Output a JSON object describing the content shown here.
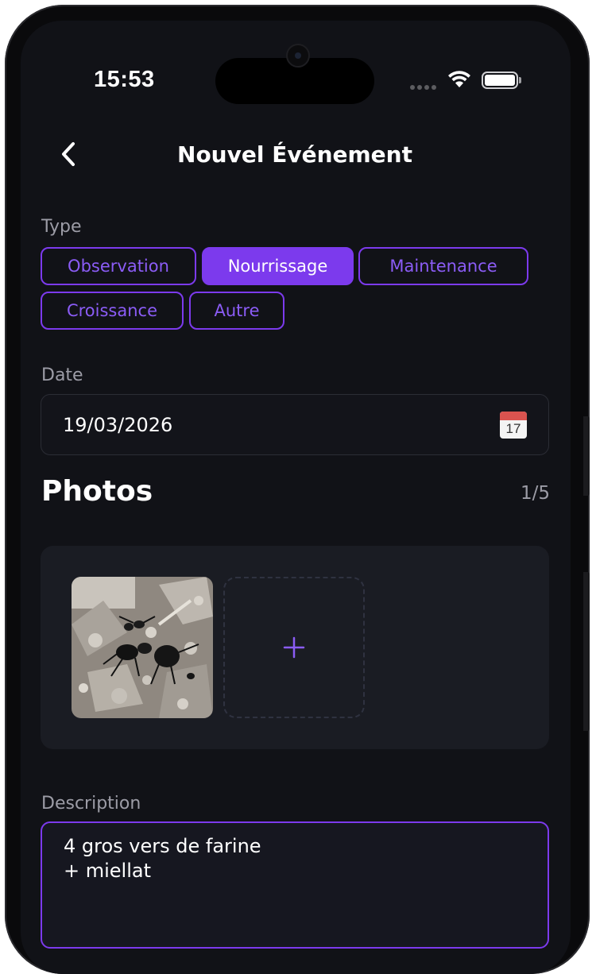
{
  "status_bar": {
    "time": "15:53"
  },
  "header": {
    "title": "Nouvel Événement",
    "back_icon": "chevron-left-icon"
  },
  "type_section": {
    "label": "Type",
    "options": [
      "Observation",
      "Nourrissage",
      "Maintenance",
      "Croissance",
      "Autre"
    ],
    "selected": "Nourrissage"
  },
  "date_section": {
    "label": "Date",
    "value": "19/03/2026",
    "calendar_icon_day": "17"
  },
  "photos_section": {
    "title": "Photos",
    "count": "1/5",
    "add_icon": "plus-icon"
  },
  "description_section": {
    "label": "Description",
    "value": "4 gros vers de farine\n+ miellat"
  },
  "colors": {
    "accent": "#7c3aed",
    "accent_text": "#8b5cf6",
    "background": "#111217",
    "card": "#1a1c23"
  }
}
